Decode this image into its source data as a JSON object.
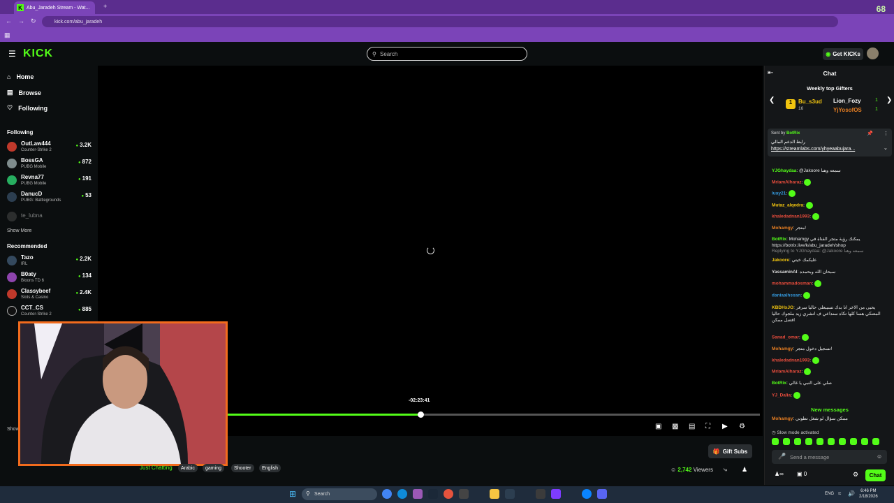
{
  "browser": {
    "tab_title": "Abu_Jaradeh Stream - Wat...",
    "url": "kick.com/abu_jaradeh",
    "counter": "68"
  },
  "header": {
    "logo": "KICK",
    "search_placeholder": "Search",
    "get_kicks_label": "Get KICKs"
  },
  "sidebar": {
    "nav": [
      {
        "label": "Home",
        "icon": "home-icon"
      },
      {
        "label": "Browse",
        "icon": "browse-icon"
      },
      {
        "label": "Following",
        "icon": "heart-icon"
      }
    ],
    "following_title": "Following",
    "following": [
      {
        "name": "OutLaw444",
        "game": "Counter-Strike 2",
        "viewers": "3.2K",
        "color": "#c0392b"
      },
      {
        "name": "BossGA",
        "game": "PUBG Mobile",
        "viewers": "872",
        "color": "#7f8c8d"
      },
      {
        "name": "Revna77",
        "game": "PUBG Mobile",
        "viewers": "191",
        "color": "#27ae60"
      },
      {
        "name": "DanucD",
        "game": "PUBG: Battlegrounds",
        "viewers": "53",
        "color": "#2c3e50"
      },
      {
        "name": "te_lubna",
        "game": "",
        "viewers": "",
        "color": "#555"
      }
    ],
    "show_more": "Show More",
    "recommended_title": "Recommended",
    "recommended": [
      {
        "name": "Tazo",
        "game": "IRL",
        "viewers": "2.2K",
        "color": "#34495e"
      },
      {
        "name": "B0aty",
        "game": "Bloons TD 6",
        "viewers": "134",
        "color": "#8e44ad"
      },
      {
        "name": "Classybeef",
        "game": "Slots & Casino",
        "viewers": "2.4K",
        "color": "#c0392b"
      },
      {
        "name": "CCT_CS",
        "game": "Counter-Strike 2",
        "viewers": "885",
        "color": "#111"
      }
    ],
    "show_more_bottom": "Show"
  },
  "player": {
    "time_tooltip": "-02:23:41",
    "progress": 0.362
  },
  "stream_info": {
    "gift_subs": "Gift Subs",
    "category": "Just Chatting",
    "tags": [
      "Arabic",
      "gaming",
      "Shooter",
      "English"
    ],
    "viewers": "2,742",
    "viewers_label": "Viewers"
  },
  "chat": {
    "title": "Chat",
    "weekly_title": "Weekly top Gifters",
    "gifters": [
      {
        "name": "Bu_s3ud",
        "count": "16"
      },
      {
        "name": "Lion_Fozy",
        "count": "1"
      },
      {
        "name": "YjYosofOS",
        "count": "1"
      }
    ],
    "pinned_by": "Sent by",
    "pinned_user": "BotRix",
    "pinned_text": "رابط الدعم المالي",
    "pinned_link": "https://streamlabs.com/yhyeaabujara...",
    "messages": [
      {
        "user": "YJGhaydaa",
        "color": "#53fc18",
        "text": "@Jakoore سمعه وهنا"
      },
      {
        "user": "MriamAlharaz",
        "color": "#e74c3c",
        "text": ""
      },
      {
        "user": "luay21",
        "color": "#3498db",
        "text": ""
      },
      {
        "user": "Mutaz_alqedra",
        "color": "#f1c40f",
        "text": ""
      },
      {
        "user": "khaledadnan1993",
        "color": "#e74c3c",
        "text": ""
      },
      {
        "user": "Mohamgy",
        "color": "#e67e22",
        "text": "متجر!"
      },
      {
        "user": "BotRix",
        "color": "#53fc18",
        "text": "Mohamgy يمكنك رؤية متجر القناة في https://botrix.live/k/abu_jaradeh/shop"
      },
      {
        "user": "Jakoore",
        "color": "#f1c40f",
        "text": "عليكمك خيتي"
      },
      {
        "user": "YassaminAl",
        "color": "#ddd",
        "text": "سبحان الله وبحمده"
      },
      {
        "user": "mohammadosman",
        "color": "#e74c3c",
        "text": ""
      },
      {
        "user": "daniaalhssan",
        "color": "#3498db",
        "text": ""
      },
      {
        "user": "KBDHxJO",
        "color": "#f1c40f",
        "text": "يحيى من الاخر انا بدك تسيبعلي حاليا سرفر المعنكي هسا كلها تكاه سنداعي ف انشري زيد ملجوك حاليا افضل ممكن"
      },
      {
        "user": "Sanad_omar",
        "color": "#e74c3c",
        "text": ""
      },
      {
        "user": "Mohamgy",
        "color": "#e67e22",
        "text": "تسجيل دخول متجر!"
      },
      {
        "user": "khaledadnan1993",
        "color": "#e74c3c",
        "text": ""
      },
      {
        "user": "MriamAlharaz",
        "color": "#e74c3c",
        "text": ""
      },
      {
        "user": "BotRix",
        "color": "#53fc18",
        "text": "صلي على النبي يا غالي"
      },
      {
        "user": "YJ_Dalia",
        "color": "#e74c3c",
        "text": ""
      }
    ],
    "reply_text": "Replying to YJGhaydaa: @Jakoore سمعه وهنا",
    "new_messages": "New messages",
    "after_message": {
      "user": "Mohamgy",
      "color": "#e67e22",
      "text": "ممكن سؤال لو شغل تطوني"
    },
    "slow_mode": "Slow mode activated",
    "input_placeholder": "Send a message",
    "chat_button": "Chat",
    "kicks_count": "0"
  },
  "taskbar": {
    "search": "Search",
    "lang": "ENG",
    "time": "6:46 PM",
    "date": "2/18/2026"
  }
}
